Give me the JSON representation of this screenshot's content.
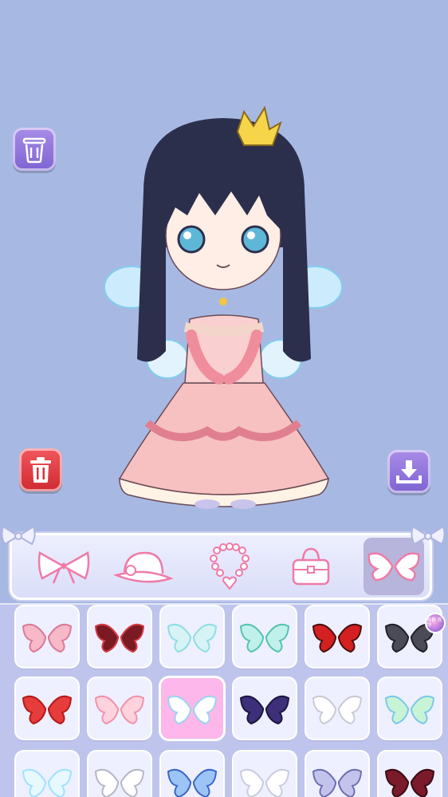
{
  "colors": {
    "background": "#a7b9e3",
    "accent_purple": "#8a6fdc",
    "delete_red": "#e03b42",
    "selected_pink": "#fdb7ea",
    "panel": "#bfc4ec"
  },
  "side_buttons": [
    {
      "name": "clear-button",
      "icon": "trash-can-outline-icon"
    },
    {
      "name": "delete-button",
      "icon": "trash-can-icon"
    },
    {
      "name": "save-button",
      "icon": "download-icon"
    }
  ],
  "categories": [
    {
      "icon": "bow-icon",
      "active": false
    },
    {
      "icon": "hat-icon",
      "active": false
    },
    {
      "icon": "necklace-icon",
      "active": false
    },
    {
      "icon": "bag-icon",
      "active": false
    },
    {
      "icon": "wings-icon",
      "active": true
    }
  ],
  "grid": {
    "selected_index": 8,
    "items": [
      {
        "icon": "pink-angel-wings-icon"
      },
      {
        "icon": "red-dark-wings-icon"
      },
      {
        "icon": "sparkle-wings-icon"
      },
      {
        "icon": "teal-fairy-wings-icon"
      },
      {
        "icon": "butterfly-wings-icon"
      },
      {
        "icon": "bat-wings-icon",
        "badge": "推荐\n视频"
      },
      {
        "icon": "red-feather-wings-icon"
      },
      {
        "icon": "small-pink-wings-icon"
      },
      {
        "icon": "white-blue-wings-icon"
      },
      {
        "icon": "purple-bat-wings-icon"
      },
      {
        "icon": "white-small-wings-icon"
      },
      {
        "icon": "aqua-butterfly-wings-icon"
      },
      {
        "icon": "glow-wings-icon"
      },
      {
        "icon": "white-angel-wings-icon"
      },
      {
        "icon": "blue-butterfly-wings-icon"
      },
      {
        "icon": "white-fluffy-wings-icon"
      },
      {
        "icon": "lavender-wings-icon"
      },
      {
        "icon": "crimson-bat-wings-icon"
      }
    ]
  }
}
